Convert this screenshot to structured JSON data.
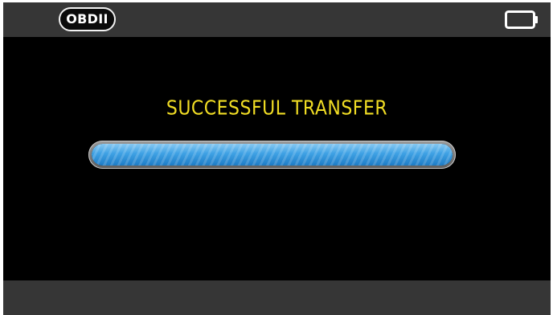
{
  "header": {
    "badge_label": "OBDII",
    "battery_icon": "battery-icon"
  },
  "main": {
    "status_message": "SUCCESSFUL TRANSFER",
    "progress": 1.0
  },
  "colors": {
    "status_text": "#f0dc24",
    "progress_fill": "#3ea1e4",
    "bars": "#363636",
    "screen": "#000000"
  }
}
